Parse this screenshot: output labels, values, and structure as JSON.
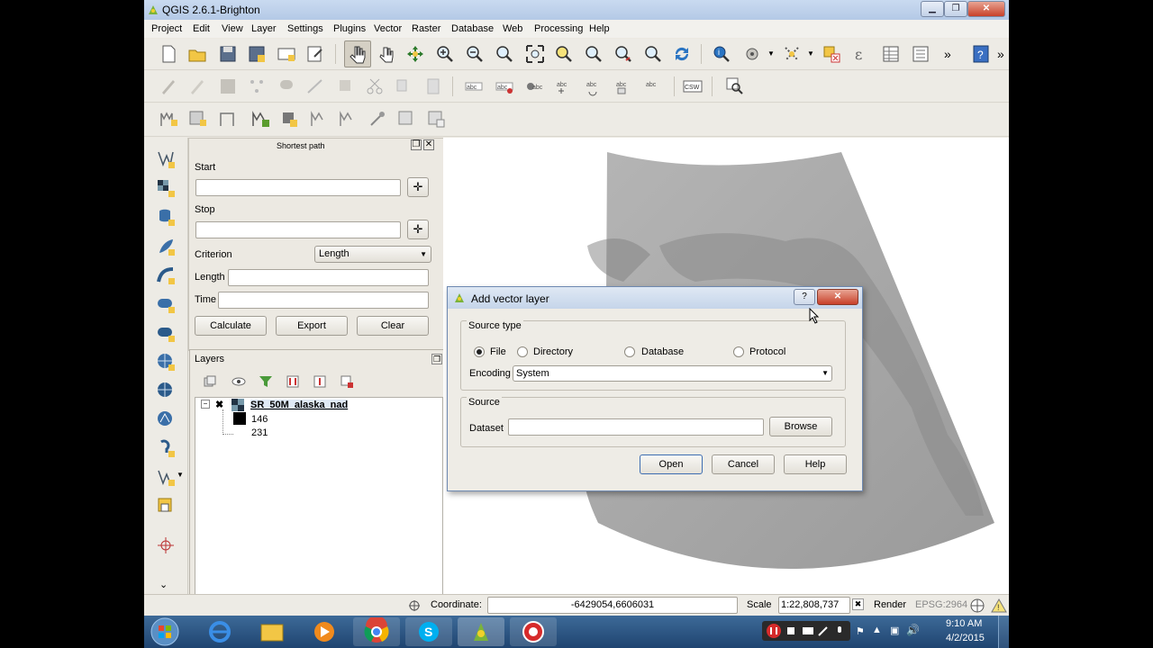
{
  "window": {
    "title": "QGIS 2.6.1-Brighton",
    "minimize": "▁",
    "maximize": "❐",
    "close": "✕"
  },
  "menu": [
    "Project",
    "Edit",
    "View",
    "Layer",
    "Settings",
    "Plugins",
    "Vector",
    "Raster",
    "Database",
    "Web",
    "Processing",
    "Help"
  ],
  "toolbar_overflow": "»",
  "shortest_path": {
    "title": "Shortest path",
    "start_label": "Start",
    "start_value": "",
    "stop_label": "Stop",
    "stop_value": "",
    "criterion_label": "Criterion",
    "criterion_value": "Length",
    "length_label": "Length",
    "length_value": "",
    "time_label": "Time",
    "time_value": "",
    "calculate": "Calculate",
    "export": "Export",
    "clear": "Clear",
    "pick_glyph": "✛",
    "dropdown_glyph": "▼"
  },
  "layers": {
    "title": "Layers",
    "layer_name": "SR_50M_alaska_nad",
    "legend_values": [
      "146",
      "231"
    ]
  },
  "dialog": {
    "title": "Add vector layer",
    "help_glyph": "?",
    "close_glyph": "✕",
    "source_type_label": "Source type",
    "options": [
      "File",
      "Directory",
      "Database",
      "Protocol"
    ],
    "selected": "File",
    "encoding_label": "Encoding",
    "encoding_value": "System",
    "source_label": "Source",
    "dataset_label": "Dataset",
    "dataset_value": "",
    "browse": "Browse",
    "open": "Open",
    "cancel": "Cancel",
    "help": "Help"
  },
  "status": {
    "coordinate_label": "Coordinate:",
    "coordinate_value": "-6429054,6606031",
    "scale_label": "Scale",
    "scale_value": "1:22,808,737",
    "render_label": "Render",
    "crs": "EPSG:2964"
  },
  "taskbar": {
    "time": "9:10 AM",
    "date": "4/2/2015"
  },
  "colors": {
    "accent": "#3d6a98",
    "record": "#d62b2b"
  }
}
